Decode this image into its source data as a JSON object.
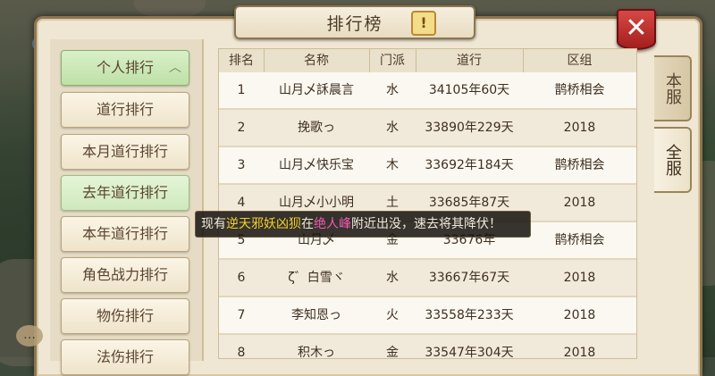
{
  "window": {
    "title": "排行榜",
    "info_icon": "!",
    "close_icon": "✕"
  },
  "sidebar": {
    "items": [
      {
        "label": "个人排行",
        "state": "active"
      },
      {
        "label": "道行排行",
        "state": "normal"
      },
      {
        "label": "本月道行排行",
        "state": "normal"
      },
      {
        "label": "去年道行排行",
        "state": "highlight"
      },
      {
        "label": "本年道行排行",
        "state": "normal"
      },
      {
        "label": "角色战力排行",
        "state": "normal"
      },
      {
        "label": "物伤排行",
        "state": "normal"
      },
      {
        "label": "法伤排行",
        "state": "normal"
      }
    ],
    "collapse_icon": "︿"
  },
  "table": {
    "headers": [
      "排名",
      "名称",
      "门派",
      "道行",
      "区组"
    ],
    "rows": [
      [
        "1",
        "山月乄訸晨言",
        "水",
        "34105年60天",
        "鹊桥相会"
      ],
      [
        "2",
        "挽歌っ",
        "水",
        "33890年229天",
        "2018"
      ],
      [
        "3",
        "山月乄快乐宝",
        "木",
        "33692年184天",
        "鹊桥相会"
      ],
      [
        "4",
        "山月乄小小明",
        "土",
        "33685年87天",
        "2018"
      ],
      [
        "5",
        "山月乄",
        "金",
        "33676年",
        "鹊桥相会"
      ],
      [
        "6",
        "ζ゛白雪ヾ",
        "水",
        "33667年67天",
        "2018"
      ],
      [
        "7",
        "李知恩っ",
        "火",
        "33558年233天",
        "2018"
      ],
      [
        "8",
        "积木っ",
        "金",
        "33547年304天",
        "2018"
      ]
    ]
  },
  "server_tabs": [
    {
      "label": "本服",
      "active": false
    },
    {
      "label": "全服",
      "active": true
    }
  ],
  "notice": {
    "prefix": "现有",
    "monster": "逆天邪妖凶狈",
    "mid": "在",
    "place": "绝人峰",
    "suffix": "附近出没，速去将其降伏！"
  },
  "colors": {
    "active_tab": "#bfe0a8",
    "close_button": "#c0302d",
    "notice_monster": "#f3d22b",
    "notice_place": "#f25ab4"
  }
}
